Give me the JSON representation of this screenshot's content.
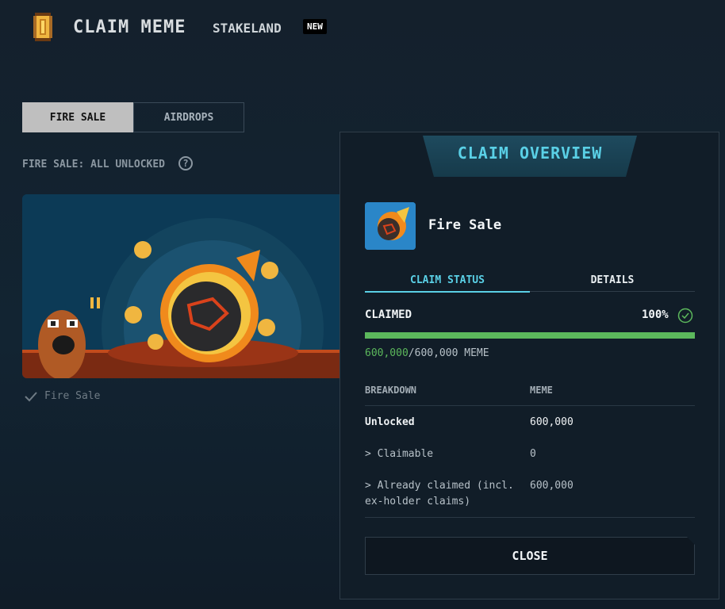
{
  "header": {
    "title": "CLAIM MEME",
    "nav_stakeland": "STAKELAND",
    "new_badge": "NEW"
  },
  "tabs": [
    {
      "label": "FIRE SALE",
      "active": true
    },
    {
      "label": "AIRDROPS",
      "active": false
    }
  ],
  "subheading": "FIRE SALE: ALL UNLOCKED",
  "help_icon": "?",
  "banner_caption": "Fire Sale",
  "modal": {
    "title": "CLAIM OVERVIEW",
    "sale_name": "Fire Sale",
    "tabs": [
      {
        "label": "CLAIM STATUS",
        "active": true
      },
      {
        "label": "DETAILS",
        "active": false
      }
    ],
    "status_label": "CLAIMED",
    "percent": "100%",
    "progress_fraction": 1.0,
    "amount_claimed": "600,000",
    "amount_total": "/600,000 MEME",
    "breakdown_headers": {
      "col1": "BREAKDOWN",
      "col2": "MEME"
    },
    "rows": [
      {
        "label": "Unlocked",
        "value": "600,000"
      },
      {
        "label": "> Claimable",
        "value": "0"
      },
      {
        "label": "> Already claimed (incl.",
        "label2": "ex-holder claims)",
        "value": "600,000"
      }
    ],
    "close_label": "CLOSE"
  },
  "colors": {
    "accent": "#5ad0e6",
    "success": "#5cb85c",
    "background": "#14202c"
  },
  "icons": [
    "coin-logo-icon",
    "help-icon",
    "check-icon",
    "check-circle-icon",
    "fireball-icon"
  ]
}
